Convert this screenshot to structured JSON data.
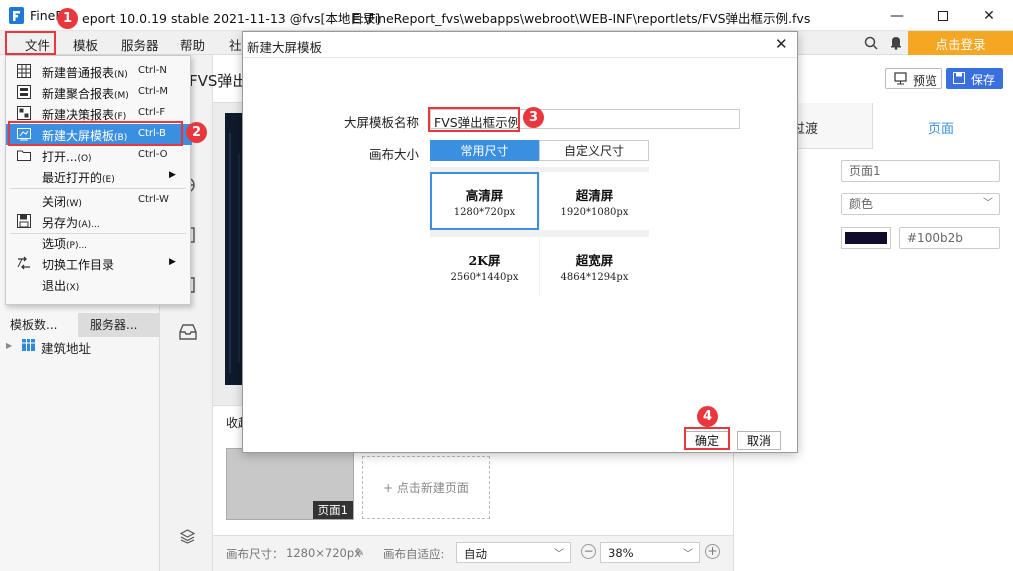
{
  "titlebar": {
    "app_prefix": "FineR",
    "app_suffix": "eport 10.0.19 stable 2021-11-13 @fvs[本地目录]",
    "path": "E:\\FineReport_fvs\\webapps\\webroot\\WEB-INF\\reportlets/FVS弹出框示例.fvs"
  },
  "menubar": {
    "file": "文件",
    "template": "模板",
    "server": "服务器",
    "help": "帮助",
    "community": "社",
    "login": "点击登录"
  },
  "file_menu": [
    {
      "label": "新建普通报表",
      "key": "(N)",
      "shortcut": "Ctrl-N",
      "icon": "grid-icon"
    },
    {
      "label": "新建聚合报表",
      "key": "(M)",
      "shortcut": "Ctrl-M",
      "icon": "aggregate-icon"
    },
    {
      "label": "新建决策报表",
      "key": "(F)",
      "shortcut": "Ctrl-F",
      "icon": "decision-icon"
    },
    {
      "label": "新建大屏模板",
      "key": "(B)",
      "shortcut": "Ctrl-B",
      "icon": "screen-icon"
    },
    {
      "label": "打开...",
      "key": "(O)",
      "shortcut": "Ctrl-O",
      "icon": "folder-icon"
    },
    {
      "label": "最近打开的",
      "key": "(E)",
      "shortcut": "",
      "icon": ""
    },
    {
      "label": "关闭",
      "key": "(W)",
      "shortcut": "Ctrl-W",
      "icon": ""
    },
    {
      "label": "另存为",
      "key": "(A)...",
      "shortcut": "",
      "icon": "save-icon"
    },
    {
      "label": "选项",
      "key": "(P)...",
      "shortcut": "",
      "icon": ""
    },
    {
      "label": "切换工作目录",
      "key": "",
      "shortcut": "",
      "icon": "switch-icon"
    },
    {
      "label": "退出",
      "key": "(X)",
      "shortcut": "",
      "icon": ""
    }
  ],
  "left": {
    "tab1": "模板数...",
    "tab2": "服务器...",
    "tree_item": "建筑地址"
  },
  "editor": {
    "tab_partial": "FVS弹出",
    "collapse_label": "收起",
    "page_thumb": "页面1",
    "new_page": "+ 点击新建页面",
    "canvas_size_label": "画布尺寸：",
    "canvas_size": "1280×720px",
    "adapt_label": "画布自适应:",
    "adapt_value": "自动",
    "zoom": "38%"
  },
  "right": {
    "preview": "预览",
    "save": "保存",
    "tab_transition": "过渡",
    "tab_page": "页面",
    "page_name": "页面1",
    "bg_type": "颜色",
    "color_hex": "#100b2b",
    "color_swatch": "#100b2b"
  },
  "dialog": {
    "title": "新建大屏模板",
    "name_label": "大屏模板名称",
    "name_value": "FVS弹出框示例",
    "canvas_label": "画布大小",
    "tab_common": "常用尺寸",
    "tab_custom": "自定义尺寸",
    "sizes": [
      {
        "name": "高清屏",
        "dim": "1280*720px"
      },
      {
        "name": "超清屏",
        "dim": "1920*1080px"
      },
      {
        "name": "2K屏",
        "dim": "2560*1440px"
      },
      {
        "name": "超宽屏",
        "dim": "4864*1294px"
      }
    ],
    "ok": "确定",
    "cancel": "取消"
  },
  "badges": [
    "1",
    "2",
    "3",
    "4"
  ],
  "colors": {
    "accent": "#3b8fe0",
    "brand": "#f5a623",
    "marker": "#e8383d",
    "save_button": "#3a6fe0"
  }
}
